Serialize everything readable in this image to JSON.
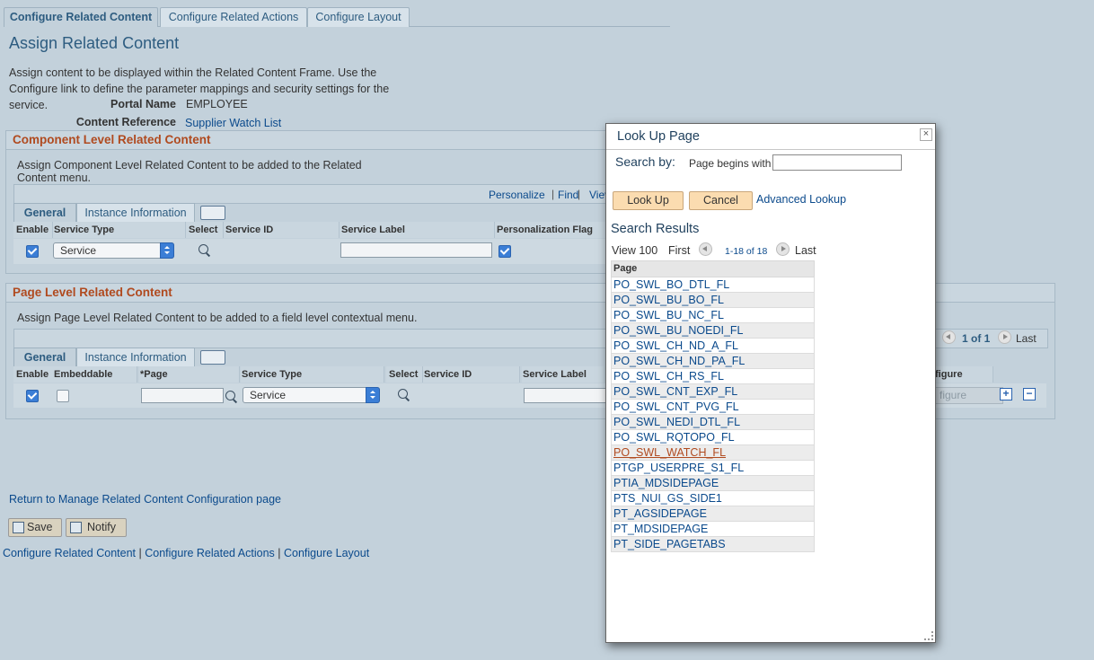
{
  "tabs": [
    {
      "label": "Configure Related Content",
      "active": true
    },
    {
      "label": "Configure Related Actions",
      "active": false
    },
    {
      "label": "Configure Layout",
      "active": false
    }
  ],
  "page_title": "Assign Related Content",
  "intro": "Assign content to be displayed within the Related Content Frame. Use the Configure link to define the parameter mappings and security settings for the service.",
  "portal_name_label": "Portal Name",
  "portal_name_value": "EMPLOYEE",
  "content_ref_label": "Content Reference",
  "content_ref_value": "Supplier Watch List",
  "component_section": {
    "title": "Component Level Related Content",
    "description": "Assign Component Level Related Content to be added to the Related Content menu.",
    "toolbar": {
      "personalize": "Personalize",
      "find": "Find",
      "view": "Viev"
    },
    "tabs": [
      "General",
      "Instance Information"
    ],
    "columns": [
      "Enable",
      "Service Type",
      "Select",
      "Service ID",
      "Service Label",
      "Personalization Flag"
    ],
    "row": {
      "service_type": "Service"
    }
  },
  "page_section": {
    "title": "Page Level Related Content",
    "description": "Assign Page Level Related Content to be added to a field level contextual menu.",
    "tabs": [
      "General",
      "Instance Information"
    ],
    "pager": {
      "count": "1 of 1",
      "last": "Last"
    },
    "columns": [
      "Enable",
      "Embeddable",
      "*Page",
      "Service Type",
      "Select",
      "Service ID",
      "Service Label",
      "figure"
    ],
    "row": {
      "service_type": "Service",
      "configure": "figure"
    }
  },
  "return_link": "Return to Manage Related Content Configuration page",
  "buttons": {
    "save": "Save",
    "notify": "Notify"
  },
  "footer_links": [
    "Configure Related Content",
    "Configure Related Actions",
    "Configure Layout"
  ],
  "footer_sep": "|",
  "lookup": {
    "title": "Look Up Page",
    "close": "×",
    "search_by": "Search by:",
    "field_label": "Page begins with",
    "field_value": "",
    "lookup_btn": "Look Up",
    "cancel_btn": "Cancel",
    "advanced": "Advanced Lookup",
    "results_title": "Search Results",
    "view": "View 100",
    "first": "First",
    "range": "1-18 of 18",
    "last": "Last",
    "column": "Page",
    "results": [
      "PO_SWL_BO_DTL_FL",
      "PO_SWL_BU_BO_FL",
      "PO_SWL_BU_NC_FL",
      "PO_SWL_BU_NOEDI_FL",
      "PO_SWL_CH_ND_A_FL",
      "PO_SWL_CH_ND_PA_FL",
      "PO_SWL_CH_RS_FL",
      "PO_SWL_CNT_EXP_FL",
      "PO_SWL_CNT_PVG_FL",
      "PO_SWL_NEDI_DTL_FL",
      "PO_SWL_RQTOPO_FL",
      "PO_SWL_WATCH_FL",
      "PTGP_USERPRE_S1_FL",
      "PTIA_MDSIDEPAGE",
      "PTS_NUI_GS_SIDE1",
      "PT_AGSIDEPAGE",
      "PT_MDSIDEPAGE",
      "PT_SIDE_PAGETABS"
    ],
    "selected_index": 11
  },
  "colors": {
    "accent": "#2d5c80",
    "section_title": "#b04a1f",
    "link": "#0b4a8c",
    "background": "#c3d1db"
  }
}
